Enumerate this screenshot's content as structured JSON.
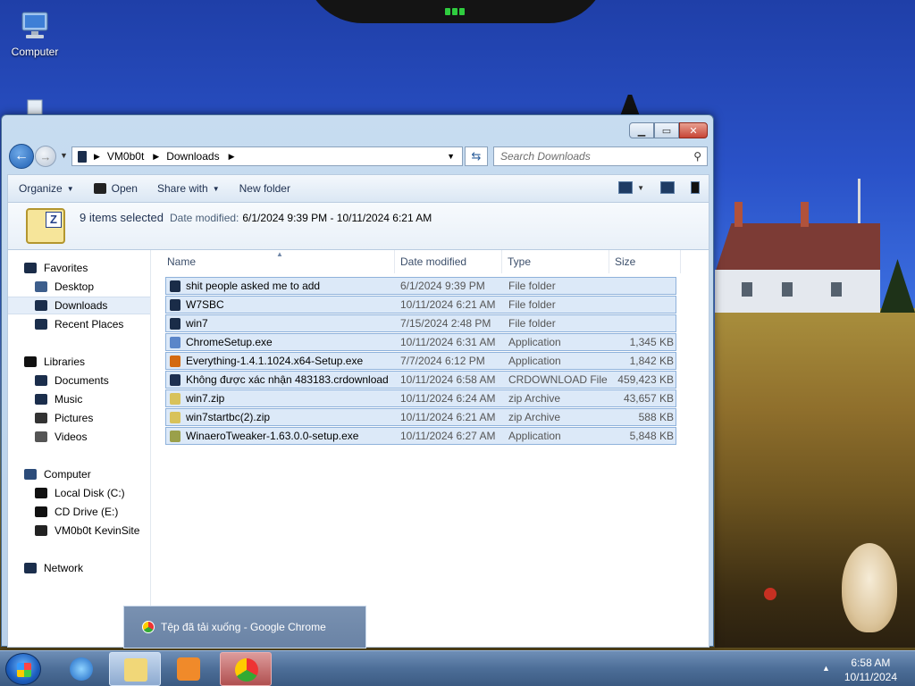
{
  "desktop": {
    "icons": [
      {
        "label": "Computer",
        "icon": "computer-icon"
      }
    ]
  },
  "window": {
    "address": {
      "segments": [
        "VM0b0t",
        "Downloads"
      ]
    },
    "search_placeholder": "Search Downloads",
    "commands": {
      "organize": "Organize",
      "open": "Open",
      "share_with": "Share with",
      "new_folder": "New folder"
    },
    "details": {
      "selection": "9 items selected",
      "date_label": "Date modified:",
      "date_value": "6/1/2024 9:39 PM - 10/11/2024 6:21 AM"
    },
    "sidebar": {
      "items": [
        {
          "label": "Favorites",
          "icon": "star-icon",
          "color": "#1a2c48"
        },
        {
          "label": "Desktop",
          "icon": "desktop-icon",
          "color": "#3d5e8c"
        },
        {
          "label": "Downloads",
          "icon": "downloads-icon",
          "color": "#1b2e4c"
        },
        {
          "label": "Recent Places",
          "icon": "recent-places-icon",
          "color": "#1b2e4c"
        },
        {
          "label": "Libraries",
          "icon": "libraries-icon",
          "color": "#111"
        },
        {
          "label": "Documents",
          "icon": "documents-icon",
          "color": "#1b2e4c"
        },
        {
          "label": "Music",
          "icon": "music-icon",
          "color": "#1b2e4c"
        },
        {
          "label": "Pictures",
          "icon": "pictures-icon",
          "color": "#333"
        },
        {
          "label": "Videos",
          "icon": "videos-icon",
          "color": "#555"
        },
        {
          "label": "Computer",
          "icon": "computer-icon",
          "color": "#2c4c7a"
        },
        {
          "label": "Local Disk (C:)",
          "icon": "drive-icon",
          "color": "#111"
        },
        {
          "label": "CD Drive (E:)",
          "icon": "cd-drive-icon",
          "color": "#111"
        },
        {
          "label": "VM0b0t KevinSite",
          "icon": "network-drive-icon",
          "color": "#222"
        },
        {
          "label": "Network",
          "icon": "network-icon",
          "color": "#1b2e4c"
        }
      ]
    },
    "columns": {
      "name": "Name",
      "date": "Date modified",
      "type": "Type",
      "size": "Size"
    },
    "files": [
      {
        "name": "shit people asked me to add",
        "date": "6/1/2024 9:39 PM",
        "type": "File folder",
        "size": "",
        "icon": "folder-icon",
        "color": "#1a2c48"
      },
      {
        "name": "W7SBC",
        "date": "10/11/2024 6:21 AM",
        "type": "File folder",
        "size": "",
        "icon": "folder-icon",
        "color": "#1a2c48"
      },
      {
        "name": "win7",
        "date": "7/15/2024 2:48 PM",
        "type": "File folder",
        "size": "",
        "icon": "folder-icon",
        "color": "#1a2c48"
      },
      {
        "name": "ChromeSetup.exe",
        "date": "10/11/2024 6:31 AM",
        "type": "Application",
        "size": "1,345 KB",
        "icon": "installer-icon",
        "color": "#5a86c9"
      },
      {
        "name": "Everything-1.4.1.1024.x64-Setup.exe",
        "date": "7/7/2024 6:12 PM",
        "type": "Application",
        "size": "1,842 KB",
        "icon": "magnifier-icon",
        "color": "#d46a10"
      },
      {
        "name": "Không được xác nhận 483183.crdownload",
        "date": "10/11/2024 6:58 AM",
        "type": "CRDOWNLOAD File",
        "size": "459,423 KB",
        "icon": "file-icon",
        "color": "#1e3050"
      },
      {
        "name": "win7.zip",
        "date": "10/11/2024 6:24 AM",
        "type": "zip Archive",
        "size": "43,657 KB",
        "icon": "zip-icon",
        "color": "#d8c25a"
      },
      {
        "name": "win7startbc(2).zip",
        "date": "10/11/2024 6:21 AM",
        "type": "zip Archive",
        "size": "588 KB",
        "icon": "zip-icon",
        "color": "#d8c25a"
      },
      {
        "name": "WinaeroTweaker-1.63.0.0-setup.exe",
        "date": "10/11/2024 6:27 AM",
        "type": "Application",
        "size": "5,848 KB",
        "icon": "installer-icon",
        "color": "#9aa04a"
      }
    ]
  },
  "tooltip": {
    "text": "Tệp đã tải xuống - Google Chrome"
  },
  "taskbar": {
    "time": "6:58 AM",
    "date": "10/11/2024"
  }
}
